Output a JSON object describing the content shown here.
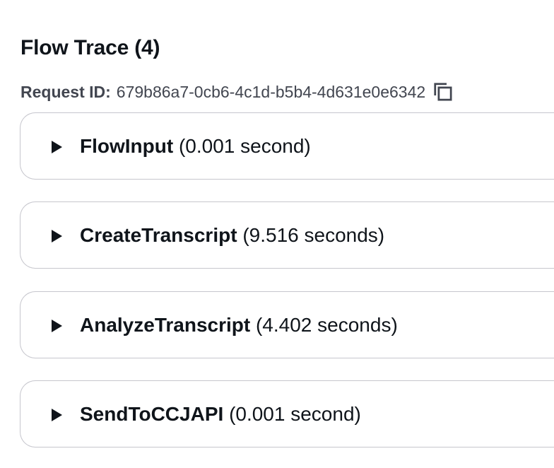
{
  "header": {
    "title": "Flow Trace",
    "count": "(4)"
  },
  "request": {
    "label": "Request ID:",
    "id": "679b86a7-0cb6-4c1d-b5b4-4d631e0e6342"
  },
  "icons": {
    "copy": "copy-icon",
    "expand": "caret-right-icon"
  },
  "traces": [
    {
      "name": "FlowInput",
      "duration": "(0.001 second)"
    },
    {
      "name": "CreateTranscript",
      "duration": "(9.516 seconds)"
    },
    {
      "name": "AnalyzeTranscript",
      "duration": "(4.402 seconds)"
    },
    {
      "name": "SendToCCJAPI",
      "duration": "(0.001 second)"
    }
  ],
  "colors": {
    "text": "#0f141a",
    "secondary_text": "#424650",
    "border": "#c6c6cd"
  }
}
